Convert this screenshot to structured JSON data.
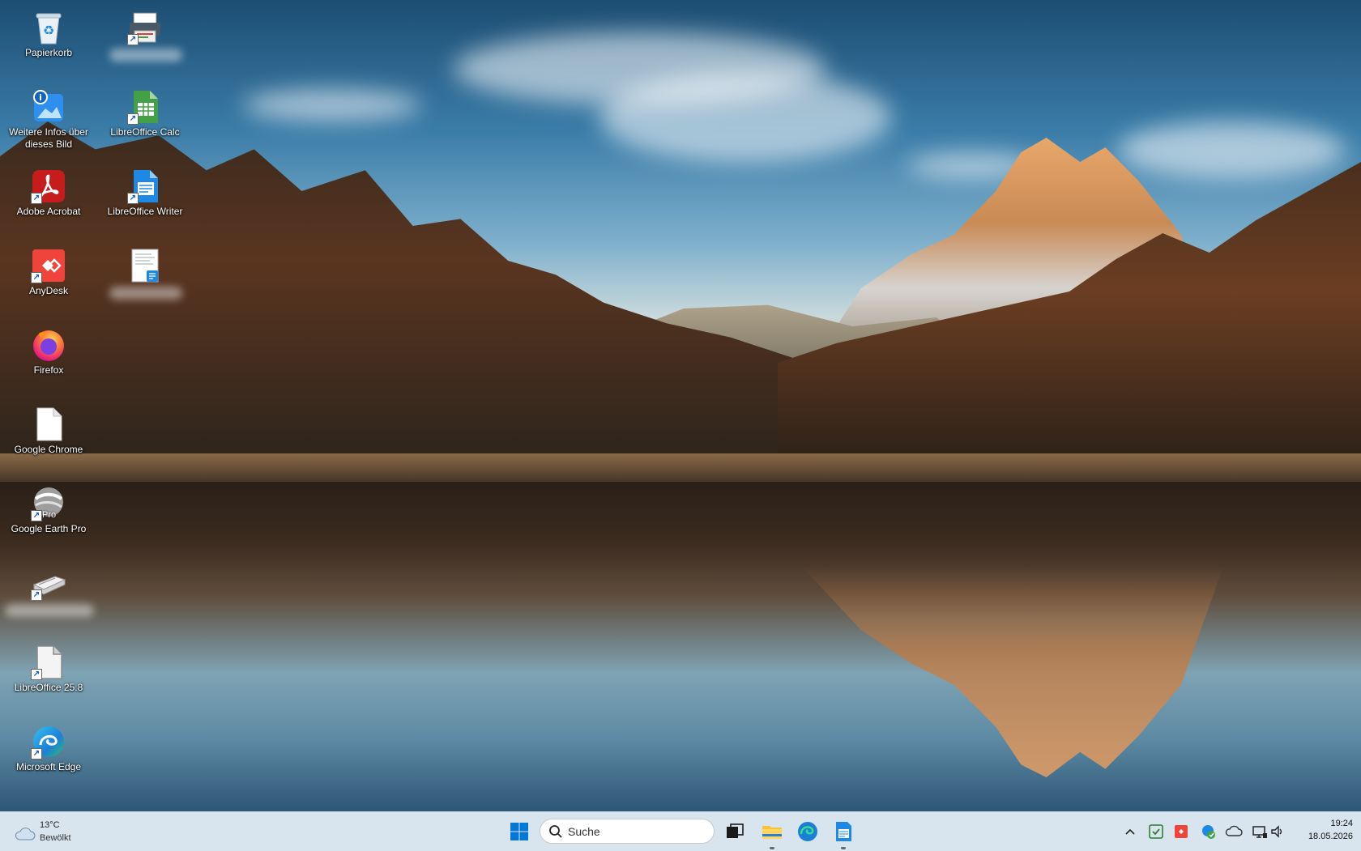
{
  "desktop": {
    "icons": [
      {
        "label": "Papierkorb"
      },
      {
        "label": ""
      },
      {
        "label": "Weitere Infos über dieses Bild"
      },
      {
        "label": "LibreOffice Calc"
      },
      {
        "label": "Adobe Acrobat"
      },
      {
        "label": "LibreOffice Writer"
      },
      {
        "label": "AnyDesk"
      },
      {
        "label": ""
      },
      {
        "label": "Firefox"
      },
      {
        "label": "Google Chrome"
      },
      {
        "label": "Google Earth Pro"
      },
      {
        "label": ""
      },
      {
        "label": "LibreOffice 25.8"
      },
      {
        "label": "Microsoft Edge"
      }
    ],
    "google_earth_badge": "Pro"
  },
  "taskbar": {
    "weather": {
      "temperature": "13°C",
      "condition": "Bewölkt"
    },
    "search_placeholder": "Suche",
    "clock": {
      "time": "19:24",
      "date": "18.05.2026"
    }
  },
  "colors": {
    "accent": "#0078d4",
    "taskbar_bg": "#d6e4ed"
  }
}
